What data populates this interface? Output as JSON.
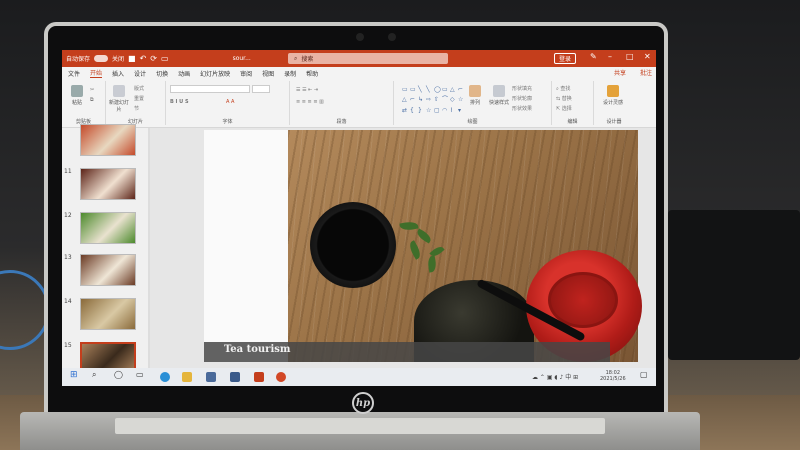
{
  "titlebar": {
    "autosave_label": "自动保存",
    "autosave_state": "关闭",
    "doc_name": "sour...",
    "search_placeholder": "搜索",
    "share_top_label": "登录"
  },
  "tabs": [
    "文件",
    "开始",
    "插入",
    "设计",
    "切换",
    "动画",
    "幻灯片放映",
    "审阅",
    "视图",
    "录制",
    "帮助"
  ],
  "active_tab": "开始",
  "share_label": "共享",
  "comment_label": "批注",
  "ribbon": {
    "clipboard": {
      "label": "剪贴板",
      "paste_label": "粘贴"
    },
    "slides": {
      "label": "幻灯片",
      "new_slide_label": "新建幻灯片",
      "layout_label": "版式",
      "reset_label": "重置",
      "section_label": "节"
    },
    "font": {
      "label": "字体"
    },
    "paragraph": {
      "label": "段落"
    },
    "drawing": {
      "label": "绘图",
      "arrange_label": "排列",
      "quick_styles_label": "快速样式",
      "fill_label": "形状填充",
      "outline_label": "形状轮廓",
      "effects_label": "形状效果"
    },
    "editing": {
      "label": "编辑",
      "find_label": "查找",
      "replace_label": "替换",
      "select_label": "选择"
    },
    "designer": {
      "label": "设计器",
      "ideas_label": "设计灵感"
    }
  },
  "thumbnails": [
    {
      "num": "",
      "colors": [
        "#c44a2a",
        "#e8d8c0"
      ]
    },
    {
      "num": "11",
      "colors": [
        "#5c2418",
        "#f0e0d0"
      ]
    },
    {
      "num": "12",
      "colors": [
        "#4c8a2c",
        "#e9e2cf"
      ]
    },
    {
      "num": "13",
      "colors": [
        "#6a3a24",
        "#efe6d6"
      ]
    },
    {
      "num": "14",
      "colors": [
        "#8a6a3a",
        "#d9c9a4"
      ]
    },
    {
      "num": "15",
      "colors": [
        "#a8805a",
        "#3a2a1c"
      ]
    }
  ],
  "selected_slide": "15",
  "slide": {
    "caption": "Tea tourism"
  },
  "taskbar": {
    "clock_time": "18:02",
    "clock_date": "2021/5/26"
  },
  "device": {
    "logo": "hp"
  }
}
